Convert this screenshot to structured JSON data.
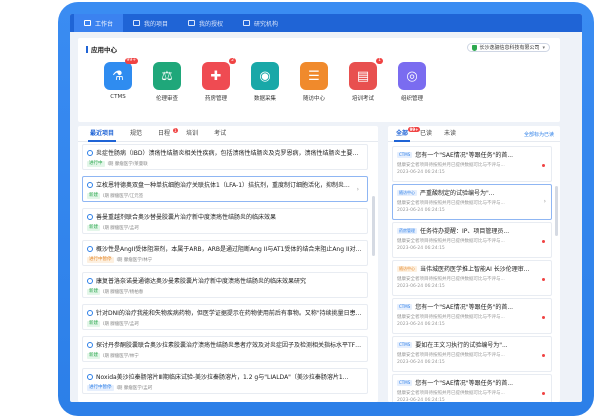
{
  "nav": {
    "tabs": [
      {
        "label": "工作台"
      },
      {
        "label": "我的项目"
      },
      {
        "label": "我的授权"
      },
      {
        "label": "研究机构"
      }
    ]
  },
  "app_center": {
    "title": "应用中心",
    "company": "长沙逸骊信息科技有限公司",
    "apps": [
      {
        "label": "CTMS",
        "icon": "flask-icon",
        "color": "#2f8cf0",
        "badge": "99+"
      },
      {
        "label": "伦理审查",
        "icon": "scale-icon",
        "color": "#1fa77a",
        "badge": ""
      },
      {
        "label": "药房管理",
        "icon": "pharmacy-icon",
        "color": "#ef4b52",
        "badge": "2"
      },
      {
        "label": "数据采集",
        "icon": "data-collect-icon",
        "color": "#19a8a8",
        "badge": ""
      },
      {
        "label": "随访中心",
        "icon": "followup-icon",
        "color": "#f08a2c",
        "badge": ""
      },
      {
        "label": "培训考试",
        "icon": "book-icon",
        "color": "#e8504f",
        "badge": "1"
      },
      {
        "label": "组织管理",
        "icon": "users-icon",
        "color": "#7a6cf0",
        "badge": ""
      }
    ]
  },
  "projects": {
    "tabs": [
      {
        "label": "最近项目",
        "badge": ""
      },
      {
        "label": "规范",
        "badge": ""
      },
      {
        "label": "日程",
        "badge": "1"
      },
      {
        "label": "培训",
        "badge": ""
      },
      {
        "label": "考试",
        "badge": ""
      }
    ],
    "items": [
      {
        "title": "炎症性肠病（IBD）溃疡性结肠炎相关性疾病，包括溃疡性结肠炎及克罗恩病，溃疡性结肠炎主要...",
        "tag": "进行中",
        "tag_color": "green",
        "meta": "I期    腺瘤医学/莱曼联"
      },
      {
        "title": "立枚恩特德奥双盘一种单抗细胞治疗关联抗体1（LFA-1）拮抗剂，重度制订细胞活化，抑制炎...",
        "tag": "新建",
        "tag_color": "green",
        "meta": "I期    腺瘤医学/江元签"
      },
      {
        "title": "善曼重越剂联合奥沙替曼胶囊片治疗新中度溃疡性结肠炎的临床效果",
        "tag": "新建",
        "tag_color": "green",
        "meta": "I期    腺瘤医学/孟珂"
      },
      {
        "title": "概沙性是AngII受体阻滞剂，本属于ARB，ARB是通过阻断Ang II与AT1受体的结合来阻止Ang II对机...",
        "tag": "进行中暂停",
        "tag_color": "orange",
        "meta": "I期    腺瘤医学/林宁"
      },
      {
        "title": "康复普洛奈诺曼通德达奥沙曼素胶囊片治疗新中度溃疡性结肠炎的临床效果研究",
        "tag": "新建",
        "tag_color": "green",
        "meta": "I期    腺瘤医学/杨柏春"
      },
      {
        "title": "针对DNI的治疗我能和失物疾病药物，但医学证据提示在药物使用前后有事物。又称\"持续挑量日患症后\"...",
        "tag": "新建",
        "tag_color": "green",
        "meta": "I期    腺瘤医学/孟珂"
      },
      {
        "title": "探讨丹参酮胶囊联合奥沙拉素胶囊治疗溃疡性结肠炎患者疗效及对炎症因子及检测相关指标水平TF、TFPI...",
        "tag": "新建",
        "tag_color": "green",
        "meta": "I期    腺瘤医学/林宁"
      },
      {
        "title": "Noxida美沙拉秦肠溶片Ⅲ期临床试验-美沙拉秦肠溶片，1.2 g与\"LIALDA\"（美沙拉秦肠溶片1...",
        "tag": "进行中暂停",
        "tag_color": "blue",
        "meta": "I期    腺瘤医学/孟珂"
      }
    ]
  },
  "messages": {
    "tabs": [
      {
        "label": "全部",
        "badge": "99+"
      },
      {
        "label": "已读",
        "badge": ""
      },
      {
        "label": "未读",
        "badge": ""
      }
    ],
    "mark_all": "全部标为已读",
    "items": [
      {
        "tag": "CTMS",
        "tag_color": "blue",
        "title": "您有一个\"SAE情况\"等跟任务\"的首...",
        "desc": "健康安全者项目待按照并月已提供数据可比与不评与...",
        "time": "2023-06-24 06:24:15",
        "unread": true
      },
      {
        "tag": "随访中心",
        "tag_color": "blue",
        "title": "严重酸制定的试验编号为\"...",
        "desc": "健康安全者项目待按照并月已提供数据可比与不评与...",
        "time": "2023-06-24 06:24:15",
        "unread": false
      },
      {
        "tag": "药房管理",
        "tag_color": "blue",
        "title": "任务待办提醒：IP、项目管理员...",
        "desc": "健康安全者项目待按照并月已提供数据可比与不评与...",
        "time": "2023-06-24 06:24:15",
        "unread": true
      },
      {
        "tag": "随访中心",
        "tag_color": "orange",
        "title": "当伟城医药医学推上智能AI 长沙伦理审...",
        "desc": "健康安全者项目待按照并月已提供数据可比与不评与...",
        "time": "2023-06-24 06:24:15",
        "unread": true
      },
      {
        "tag": "CTMS",
        "tag_color": "blue",
        "title": "您有一个\"SAE情况\"等跟任务\"的首...",
        "desc": "健康安全者项目待按照并月已提供数据可比与不评与...",
        "time": "2023-06-24 06:24:15",
        "unread": true
      },
      {
        "tag": "CTMS",
        "tag_color": "blue",
        "title": "要如在王文习执行的试验编号为\"...",
        "desc": "健康安全者项目待按照并月已提供数据可比与不评与...",
        "time": "2023-06-24 06:24:15",
        "unread": true
      },
      {
        "tag": "CTMS",
        "tag_color": "blue",
        "title": "您有一个\"SAE情况\"等跟任务\"的首...",
        "desc": "健康安全者项目待按照并月已提供数据可比与不评与...",
        "time": "2023-06-24 06:24:15",
        "unread": true
      }
    ]
  }
}
